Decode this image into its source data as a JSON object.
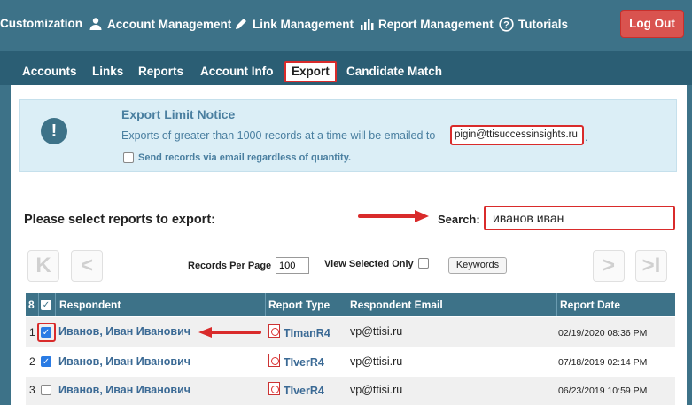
{
  "nav": {
    "items": [
      "Customization",
      "Account Management",
      "Link Management",
      "Report Management",
      "Tutorials"
    ],
    "logout_label": "Log Out"
  },
  "tabs": {
    "accounts": "Accounts",
    "links": "Links",
    "reports": "Reports",
    "account_info": "Account Info",
    "export": "Export",
    "candidate_match": "Candidate Match"
  },
  "notice": {
    "icon": "!",
    "title": "Export Limit Notice",
    "text": "Exports of greater than 1000 records at a time will be emailed to",
    "email": "pigin@ttisuccessinsights.ru",
    "period": ".",
    "send_label": "Send records via email regardless of quantity."
  },
  "select": {
    "label": "Please select reports to export:",
    "search_label": "Search:",
    "search_value": "иванов иван"
  },
  "pager": {
    "first": "K",
    "prev": "<",
    "next": ">",
    "last": ">I",
    "rpp_label": "Records Per Page",
    "rpp_value": "100",
    "view_selected_label": "View Selected Only",
    "keywords_label": "Keywords"
  },
  "table": {
    "count": "8",
    "headers": {
      "respondent": "Respondent",
      "report_type": "Report Type",
      "email": "Respondent Email",
      "date": "Report Date"
    },
    "rows": [
      {
        "num": "1",
        "checked": true,
        "name": "Иванов,  Иван Иванович",
        "type": "TImanR4",
        "email": "vp@ttisi.ru",
        "date": "02/19/2020 08:36 PM"
      },
      {
        "num": "2",
        "checked": true,
        "name": "Иванов, Иван Иванович",
        "type": "TIverR4",
        "email": "vp@ttisi.ru",
        "date": "07/18/2019 02:14 PM"
      },
      {
        "num": "3",
        "checked": false,
        "name": "Иванов, Иван Иванович",
        "type": "TIverR4",
        "email": "vp@ttisi.ru",
        "date": "06/23/2019 10:59 PM"
      }
    ]
  },
  "colors": {
    "header_bg": "#3d7288",
    "highlight_red": "#d92b2b",
    "logout_bg": "#d9534f",
    "link_blue": "#3b6a95"
  }
}
